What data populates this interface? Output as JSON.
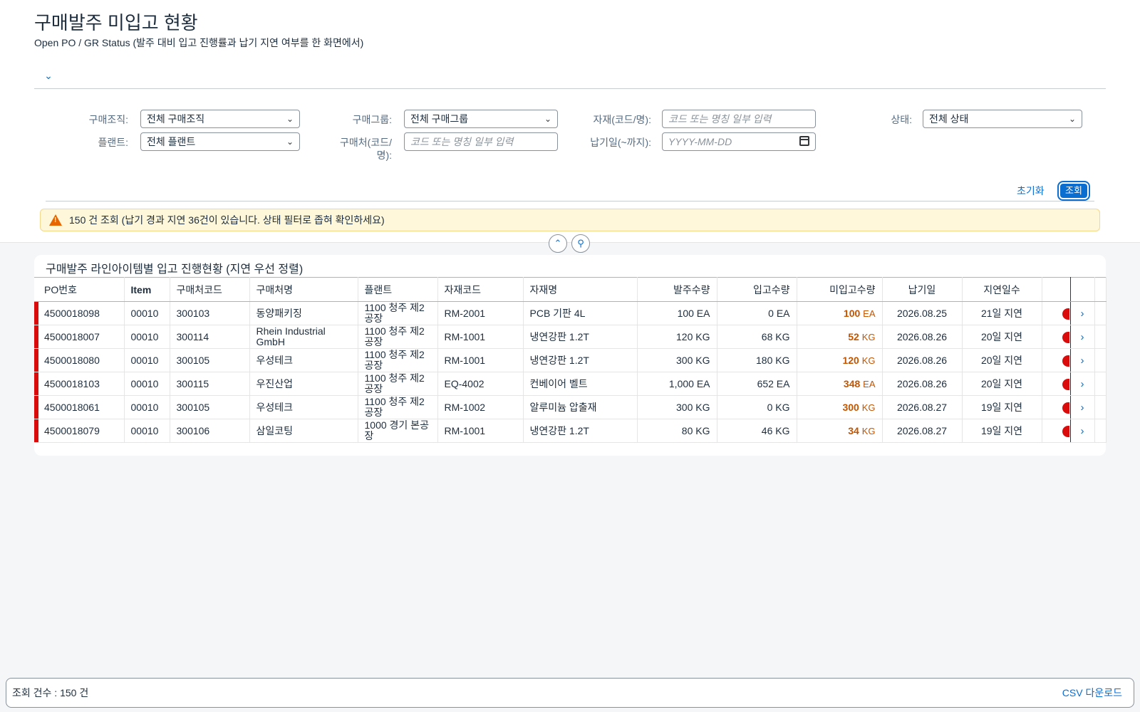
{
  "page": {
    "title": "구매발주 미입고 현황",
    "subtitle": "Open PO / GR Status (발주 대비 입고 진행률과 납기 지연 여부를 한 화면에서)"
  },
  "filters": {
    "purch_org": {
      "label": "구매조직:",
      "value": "전체 구매조직"
    },
    "purch_group": {
      "label": "구매그룹:",
      "value": "전체 구매그룹"
    },
    "material": {
      "label": "자재(코드/명):",
      "placeholder": "코드 또는 명칭 일부 입력"
    },
    "status": {
      "label": "상태:",
      "value": "전체 상태"
    },
    "plant": {
      "label": "플랜트:",
      "value": "전체 플랜트"
    },
    "vendor": {
      "label": "구매처(코드/명):",
      "placeholder": "코드 또는 명칭 일부 입력"
    },
    "delivery_date": {
      "label": "납기일(~까지):",
      "placeholder": "YYYY-MM-DD"
    }
  },
  "actions": {
    "reset": "초기화",
    "search": "조회"
  },
  "message": "150 건 조회 (납기 경과 지연 36건이 있습니다. 상태 필터로 좁혀 확인하세요)",
  "table": {
    "title": "구매발주 라인아이템별 입고 진행현황 (지연 우선 정렬)",
    "columns": [
      "PO번호",
      "Item",
      "구매처코드",
      "구매처명",
      "플랜트",
      "자재코드",
      "자재명",
      "발주수량",
      "입고수량",
      "미입고수량",
      "납기일",
      "지연일수"
    ],
    "rows": [
      {
        "po": "4500018098",
        "item": "00010",
        "vendor_code": "300103",
        "vendor": "동양패키징",
        "plant": "1100 청주 제2공장",
        "mat_code": "RM-2001",
        "mat_name": "PCB 기판 4L",
        "order_qty": "100 EA",
        "gr_qty": "0 EA",
        "open_qty": "100",
        "open_unit": "EA",
        "due": "2026.08.25",
        "delay": "21일 지연"
      },
      {
        "po": "4500018007",
        "item": "00010",
        "vendor_code": "300114",
        "vendor": "Rhein Industrial GmbH",
        "plant": "1100 청주 제2공장",
        "mat_code": "RM-1001",
        "mat_name": "냉연강판 1.2T",
        "order_qty": "120 KG",
        "gr_qty": "68 KG",
        "open_qty": "52",
        "open_unit": "KG",
        "due": "2026.08.26",
        "delay": "20일 지연"
      },
      {
        "po": "4500018080",
        "item": "00010",
        "vendor_code": "300105",
        "vendor": "우성테크",
        "plant": "1100 청주 제2공장",
        "mat_code": "RM-1001",
        "mat_name": "냉연강판 1.2T",
        "order_qty": "300 KG",
        "gr_qty": "180 KG",
        "open_qty": "120",
        "open_unit": "KG",
        "due": "2026.08.26",
        "delay": "20일 지연"
      },
      {
        "po": "4500018103",
        "item": "00010",
        "vendor_code": "300115",
        "vendor": "우진산업",
        "plant": "1100 청주 제2공장",
        "mat_code": "EQ-4002",
        "mat_name": "컨베이어 벨트",
        "order_qty": "1,000 EA",
        "gr_qty": "652 EA",
        "open_qty": "348",
        "open_unit": "EA",
        "due": "2026.08.26",
        "delay": "20일 지연"
      },
      {
        "po": "4500018061",
        "item": "00010",
        "vendor_code": "300105",
        "vendor": "우성테크",
        "plant": "1100 청주 제2공장",
        "mat_code": "RM-1002",
        "mat_name": "알루미늄 압출재",
        "order_qty": "300 KG",
        "gr_qty": "0 KG",
        "open_qty": "300",
        "open_unit": "KG",
        "due": "2026.08.27",
        "delay": "19일 지연"
      },
      {
        "po": "4500018079",
        "item": "00010",
        "vendor_code": "300106",
        "vendor": "삼일코팅",
        "plant": "1000 경기 본공장",
        "mat_code": "RM-1001",
        "mat_name": "냉연강판 1.2T",
        "order_qty": "80 KG",
        "gr_qty": "46 KG",
        "open_qty": "34",
        "open_unit": "KG",
        "due": "2026.08.27",
        "delay": "19일 지연"
      }
    ]
  },
  "footer": {
    "count": "조회 건수 : 150 건",
    "csv": "CSV 다운로드"
  }
}
